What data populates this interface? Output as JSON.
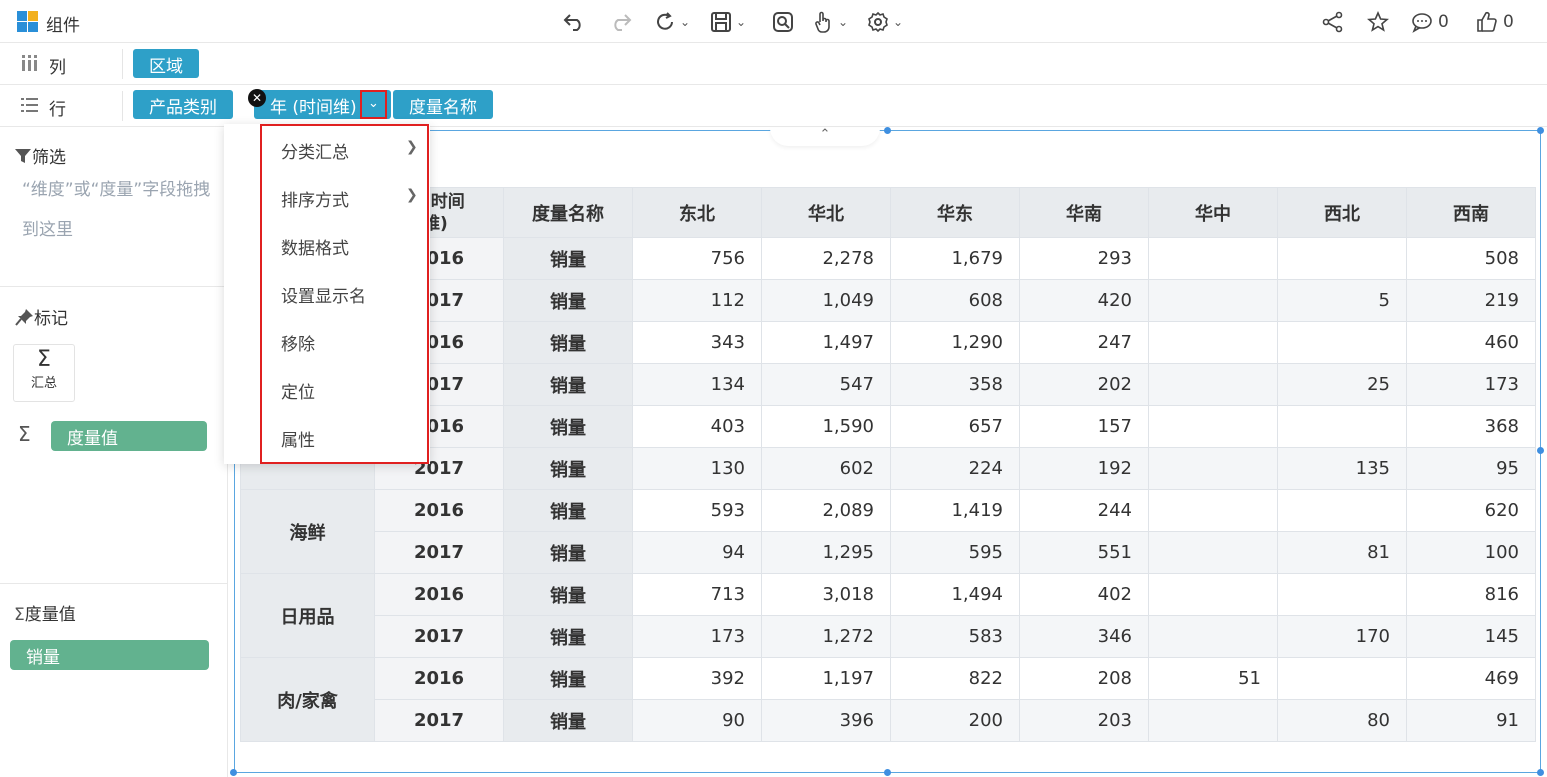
{
  "app": {
    "title": "组件"
  },
  "toolbar": {
    "undo_icon": "undo-icon",
    "redo_icon": "redo-icon",
    "refresh_icon": "refresh-icon",
    "save_icon": "save-icon",
    "preview_icon": "preview-icon",
    "interact_icon": "hand-pointer-icon",
    "settings_icon": "gear-icon",
    "share_icon": "share-icon",
    "star_icon": "star-icon",
    "comment_count": "0",
    "like_count": "0"
  },
  "shelves": {
    "columns": {
      "label": "列",
      "pills": [
        "区域"
      ]
    },
    "rows": {
      "label": "行",
      "pills": [
        "产品类别",
        "年 (时间维)",
        "度量名称"
      ]
    }
  },
  "left_panel": {
    "filter_title": "筛选",
    "filter_hint": "“维度”或“度量”字段拖拽到这里",
    "marks_title": "标记",
    "marks_summary_label": "汇总",
    "marks_measure_pill": "度量值",
    "measures_title": "度量值",
    "measures_pill": "销量"
  },
  "context_menu": {
    "items": [
      {
        "label": "分类汇总",
        "submenu": true
      },
      {
        "label": "排序方式",
        "submenu": true
      },
      {
        "label": "数据格式",
        "submenu": false
      },
      {
        "label": "设置显示名",
        "submenu": false
      },
      {
        "label": "移除",
        "submenu": false
      },
      {
        "label": "定位",
        "submenu": false
      },
      {
        "label": "属性",
        "submenu": false
      }
    ]
  },
  "table": {
    "headers": [
      "年 (时间维)",
      "度量名称",
      "东北",
      "华北",
      "华东",
      "华南",
      "华中",
      "西北",
      "西南"
    ],
    "header_visible_year": "(时间\n维)",
    "rows": [
      {
        "category": "",
        "year": "2016",
        "measure": "销量",
        "values": [
          "756",
          "2,278",
          "1,679",
          "293",
          "",
          "",
          "508"
        ]
      },
      {
        "category": "",
        "year": "2017",
        "measure": "销量",
        "values": [
          "112",
          "1,049",
          "608",
          "420",
          "",
          "5",
          "219"
        ]
      },
      {
        "category": "",
        "year": "2016",
        "measure": "销量",
        "values": [
          "343",
          "1,497",
          "1,290",
          "247",
          "",
          "",
          "460"
        ]
      },
      {
        "category": "",
        "year": "2017",
        "measure": "销量",
        "values": [
          "134",
          "547",
          "358",
          "202",
          "",
          "25",
          "173"
        ]
      },
      {
        "category": "",
        "year": "2016",
        "measure": "销量",
        "values": [
          "403",
          "1,590",
          "657",
          "157",
          "",
          "",
          "368"
        ]
      },
      {
        "category": "",
        "year": "2017",
        "measure": "销量",
        "values": [
          "130",
          "602",
          "224",
          "192",
          "",
          "135",
          "95"
        ]
      },
      {
        "category": "海鲜",
        "year": "2016",
        "measure": "销量",
        "values": [
          "593",
          "2,089",
          "1,419",
          "244",
          "",
          "",
          "620"
        ]
      },
      {
        "category": "",
        "year": "2017",
        "measure": "销量",
        "values": [
          "94",
          "1,295",
          "595",
          "551",
          "",
          "81",
          "100"
        ]
      },
      {
        "category": "日用品",
        "year": "2016",
        "measure": "销量",
        "values": [
          "713",
          "3,018",
          "1,494",
          "402",
          "",
          "",
          "816"
        ]
      },
      {
        "category": "",
        "year": "2017",
        "measure": "销量",
        "values": [
          "173",
          "1,272",
          "583",
          "346",
          "",
          "170",
          "145"
        ]
      },
      {
        "category": "肉/家禽",
        "year": "2016",
        "measure": "销量",
        "values": [
          "392",
          "1,197",
          "822",
          "208",
          "51",
          "",
          "469"
        ]
      },
      {
        "category": "",
        "year": "2017",
        "measure": "销量",
        "values": [
          "90",
          "396",
          "200",
          "203",
          "",
          "80",
          "91"
        ]
      }
    ]
  },
  "colors": {
    "pill_blue": "#2ea0c8",
    "pill_green": "#62b28f",
    "highlight_red": "#e02020",
    "selection_blue": "#3f8fe0"
  }
}
